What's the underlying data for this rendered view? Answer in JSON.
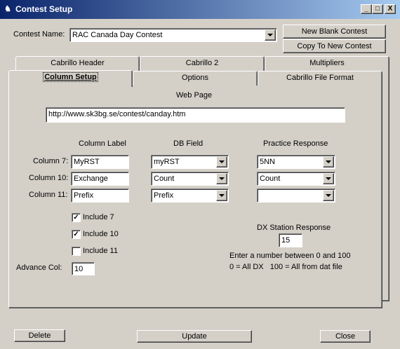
{
  "window": {
    "title": "Contest Setup",
    "controls": {
      "minimize": "_",
      "maximize": "□",
      "close": "X"
    }
  },
  "contest": {
    "label": "Contest Name:",
    "value": "RAC Canada Day Contest",
    "new_blank_button": "New Blank Contest",
    "copy_button": "Copy To New Contest"
  },
  "tabs": {
    "row_back": [
      "Cabrillo Header",
      "Cabrillo 2",
      "Multipliers"
    ],
    "row_front": [
      "Column Setup",
      "Options",
      "Cabrillo File Format"
    ],
    "active": "Column Setup"
  },
  "web_page": {
    "label": "Web Page",
    "url": "http://www.sk3bg.se/contest/canday.htm"
  },
  "columns": {
    "headers": {
      "label": "Column Label",
      "db_field": "DB Field",
      "practice": "Practice Response"
    },
    "rows": [
      {
        "name": "Column 7:",
        "label": "MyRST",
        "db_field": "myRST",
        "practice": "5NN"
      },
      {
        "name": "Column 10:",
        "label": "Exchange",
        "db_field": "Count",
        "practice": "Count"
      },
      {
        "name": "Column 11:",
        "label": "Prefix",
        "db_field": "Prefix",
        "practice": ""
      }
    ]
  },
  "includes": [
    {
      "label": "Include 7",
      "checked": true
    },
    {
      "label": "Include 10",
      "checked": true
    },
    {
      "label": "Include 11",
      "checked": false
    }
  ],
  "advance": {
    "label": "Advance Col:",
    "value": "10"
  },
  "dx": {
    "label": "DX Station Response",
    "value": "15",
    "hint1": "Enter a number between 0 and 100",
    "hint2": "0 = All DX   100 = All from dat file"
  },
  "footer": {
    "delete": "Delete",
    "update": "Update",
    "close": "Close"
  }
}
